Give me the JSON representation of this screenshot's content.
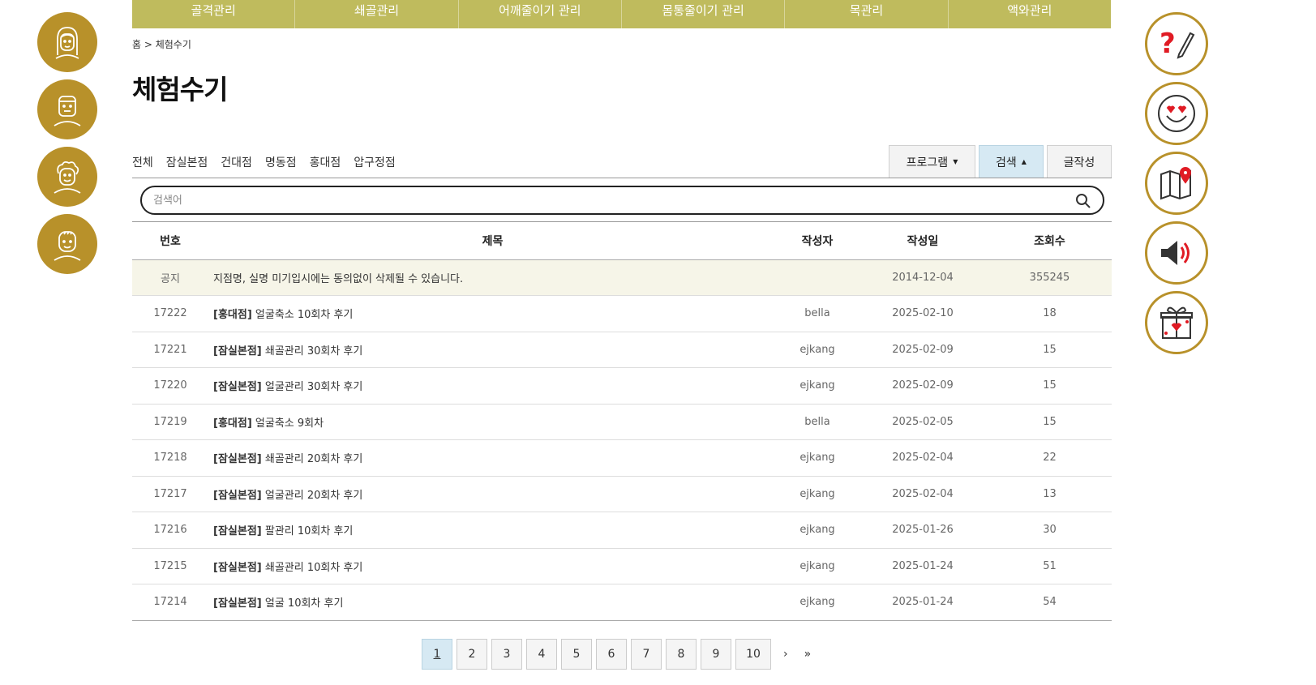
{
  "nav": [
    "골격관리",
    "쇄골관리",
    "어깨줄이기 관리",
    "몸통줄이기 관리",
    "목관리",
    "액와관리"
  ],
  "breadcrumb": "홈 > 체험수기",
  "title": "체험수기",
  "branches": [
    "전체",
    "잠실본점",
    "건대점",
    "명동점",
    "홍대점",
    "압구정점"
  ],
  "tools": {
    "program": "프로그램",
    "search": "검색",
    "write": "글작성"
  },
  "search": {
    "placeholder": "검색어"
  },
  "table": {
    "headers": [
      "번호",
      "제목",
      "작성자",
      "작성일",
      "조회수"
    ],
    "notice": {
      "num": "공지",
      "title": "지점명, 실명 미기입시에는 동의없이 삭제될 수 있습니다.",
      "author": "",
      "date": "2014-12-04",
      "views": "355245"
    },
    "rows": [
      {
        "num": "17222",
        "branch": "[홍대점]",
        "title": " 얼굴축소 10회차 후기",
        "author": "bella",
        "date": "2025-02-10",
        "views": "18"
      },
      {
        "num": "17221",
        "branch": "[잠실본점]",
        "title": " 쇄골관리 30회차 후기",
        "author": "ejkang",
        "date": "2025-02-09",
        "views": "15"
      },
      {
        "num": "17220",
        "branch": "[잠실본점]",
        "title": " 얼굴관리 30회차 후기",
        "author": "ejkang",
        "date": "2025-02-09",
        "views": "15"
      },
      {
        "num": "17219",
        "branch": "[홍대점]",
        "title": " 얼굴축소 9회차",
        "author": "bella",
        "date": "2025-02-05",
        "views": "15"
      },
      {
        "num": "17218",
        "branch": "[잠실본점]",
        "title": " 쇄골관리 20회차 후기",
        "author": "ejkang",
        "date": "2025-02-04",
        "views": "22"
      },
      {
        "num": "17217",
        "branch": "[잠실본점]",
        "title": " 얼굴관리 20회차 후기",
        "author": "ejkang",
        "date": "2025-02-04",
        "views": "13"
      },
      {
        "num": "17216",
        "branch": "[잠실본점]",
        "title": " 팔관리 10회차 후기",
        "author": "ejkang",
        "date": "2025-01-26",
        "views": "30"
      },
      {
        "num": "17215",
        "branch": "[잠실본점]",
        "title": " 쇄골관리 10회차 후기",
        "author": "ejkang",
        "date": "2025-01-24",
        "views": "51"
      },
      {
        "num": "17214",
        "branch": "[잠실본점]",
        "title": " 얼굴 10회차 후기",
        "author": "ejkang",
        "date": "2025-01-24",
        "views": "54"
      }
    ]
  },
  "pagination": {
    "pages": [
      "1",
      "2",
      "3",
      "4",
      "5",
      "6",
      "7",
      "8",
      "9",
      "10"
    ],
    "current": "1",
    "next": "›",
    "last": "»"
  },
  "left_icons": [
    "woman-face-icon",
    "man-face-icon",
    "curly-hair-face-icon",
    "balding-face-icon"
  ],
  "right_icons": [
    "question-pencil-icon",
    "heart-eyes-smiley-icon",
    "map-pin-icon",
    "speaker-icon",
    "gift-box-icon"
  ],
  "colors": {
    "nav": "#bfbb5d",
    "gold": "#b8912a",
    "active": "#d6e9f3",
    "notice_bg": "#f6f5e8"
  }
}
